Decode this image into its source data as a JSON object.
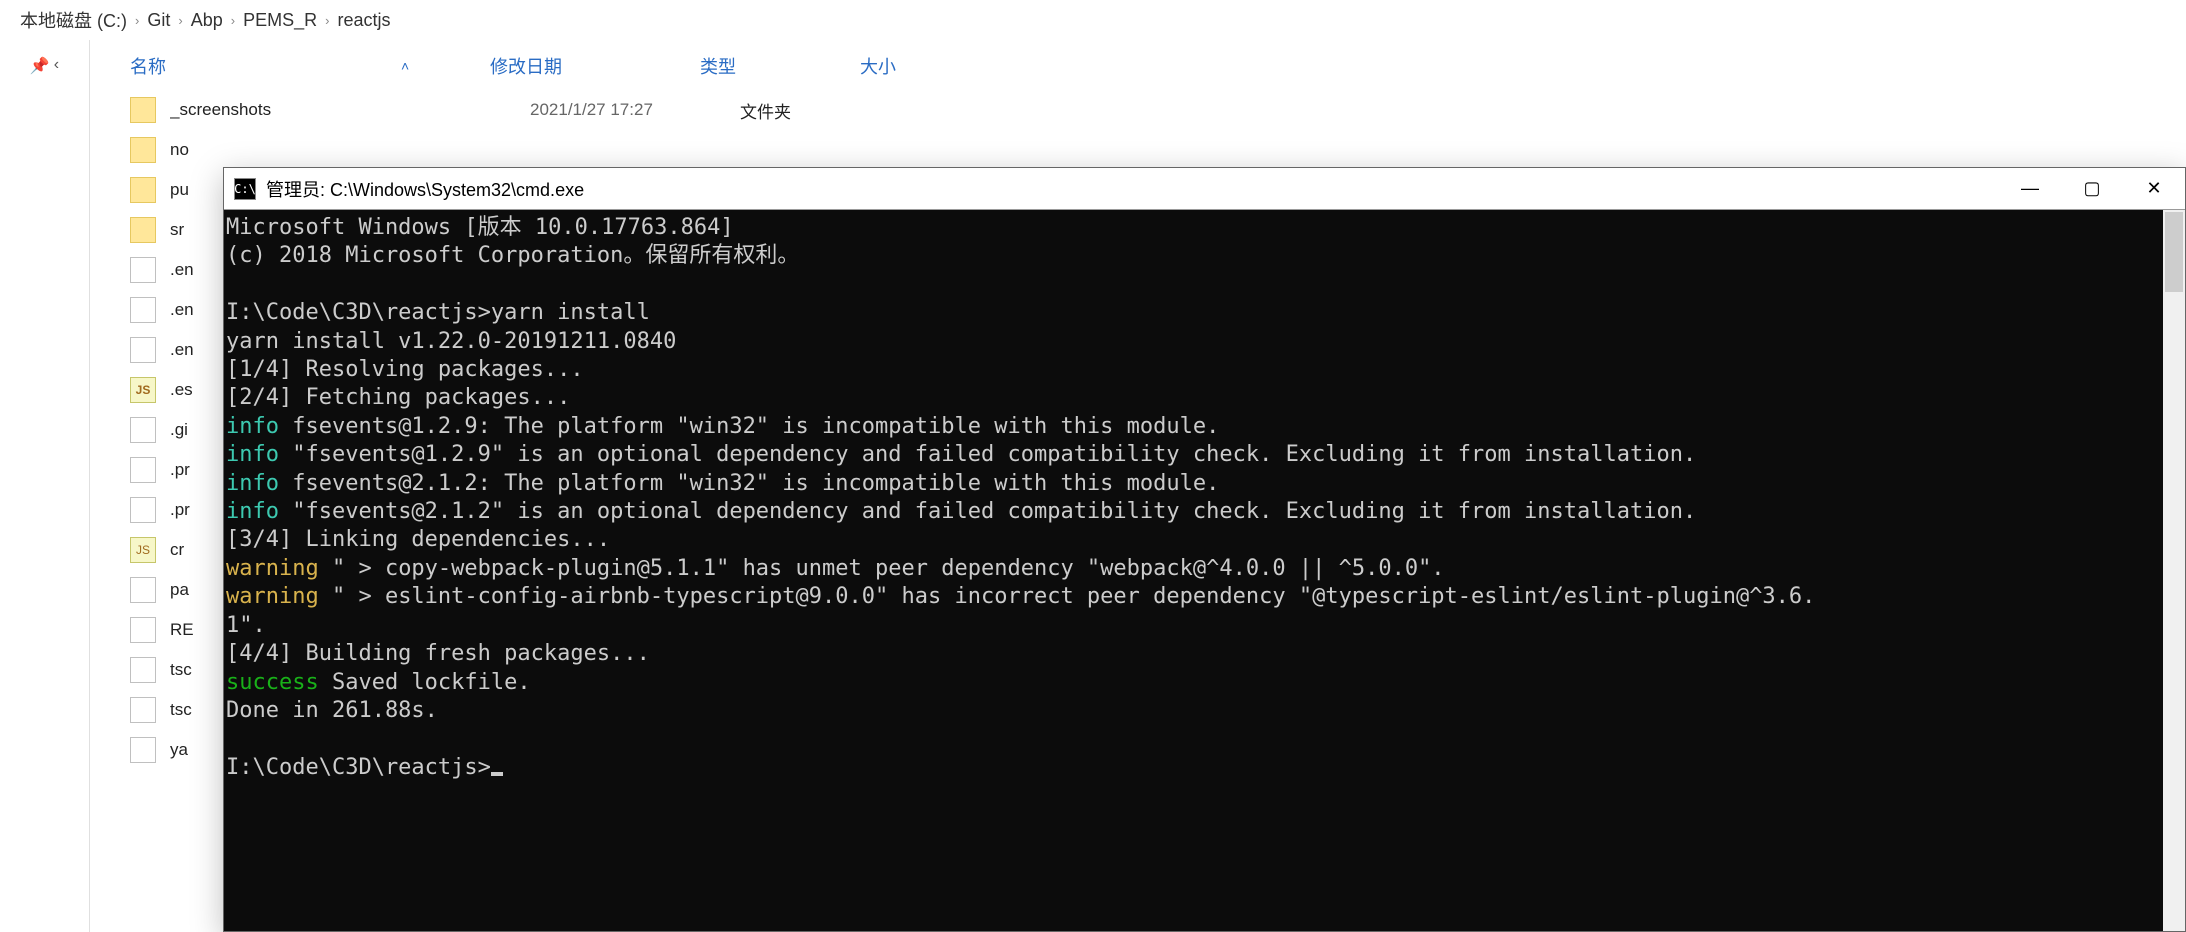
{
  "breadcrumb": [
    "本地磁盘 (C:)",
    "Git",
    "Abp",
    "PEMS_R",
    "reactjs"
  ],
  "columns": {
    "name": "名称",
    "modified": "修改日期",
    "type": "类型",
    "size": "大小"
  },
  "files": [
    {
      "icon": "folder",
      "name": "_screenshots",
      "date": "2021/1/27 17:27",
      "type": "文件夹",
      "size": ""
    },
    {
      "icon": "folder",
      "name": "no",
      "date": "",
      "type": "",
      "size": ""
    },
    {
      "icon": "folder",
      "name": "pu",
      "date": "",
      "type": "",
      "size": ""
    },
    {
      "icon": "folder",
      "name": "sr",
      "date": "",
      "type": "",
      "size": ""
    },
    {
      "icon": "doc",
      "name": ".en",
      "date": "",
      "type": "",
      "size": ""
    },
    {
      "icon": "doc",
      "name": ".en",
      "date": "",
      "type": "",
      "size": ""
    },
    {
      "icon": "doc",
      "name": ".en",
      "date": "",
      "type": "",
      "size": ""
    },
    {
      "icon": "eslint",
      "name": ".es",
      "date": "",
      "type": "",
      "size": ""
    },
    {
      "icon": "doc",
      "name": ".gi",
      "date": "",
      "type": "",
      "size": ""
    },
    {
      "icon": "doc",
      "name": ".pr",
      "date": "",
      "type": "",
      "size": ""
    },
    {
      "icon": "doc",
      "name": ".pr",
      "date": "",
      "type": "",
      "size": ""
    },
    {
      "icon": "craco",
      "name": "cr",
      "date": "",
      "type": "",
      "size": ""
    },
    {
      "icon": "doc",
      "name": "pa",
      "date": "",
      "type": "",
      "size": ""
    },
    {
      "icon": "doc",
      "name": "RE",
      "date": "",
      "type": "",
      "size": ""
    },
    {
      "icon": "doc",
      "name": "tsc",
      "date": "",
      "type": "",
      "size": ""
    },
    {
      "icon": "doc",
      "name": "tsc",
      "date": "",
      "type": "",
      "size": ""
    },
    {
      "icon": "doc",
      "name": "ya",
      "date": "",
      "type": "",
      "size": ""
    }
  ],
  "cmd": {
    "title": "管理员: C:\\Windows\\System32\\cmd.exe",
    "lines": [
      {
        "plain": "Microsoft Windows [版本 10.0.17763.864]"
      },
      {
        "plain": "(c) 2018 Microsoft Corporation。保留所有权利。"
      },
      {
        "plain": ""
      },
      {
        "plain": "I:\\Code\\C3D\\reactjs>yarn install"
      },
      {
        "plain": "yarn install v1.22.0-20191211.0840"
      },
      {
        "plain": "[1/4] Resolving packages..."
      },
      {
        "plain": "[2/4] Fetching packages..."
      },
      {
        "prefix": "info",
        "prefixClass": "t-info",
        "rest": " fsevents@1.2.9: The platform \"win32\" is incompatible with this module."
      },
      {
        "prefix": "info",
        "prefixClass": "t-info",
        "rest": " \"fsevents@1.2.9\" is an optional dependency and failed compatibility check. Excluding it from installation."
      },
      {
        "prefix": "info",
        "prefixClass": "t-info",
        "rest": " fsevents@2.1.2: The platform \"win32\" is incompatible with this module."
      },
      {
        "prefix": "info",
        "prefixClass": "t-info",
        "rest": " \"fsevents@2.1.2\" is an optional dependency and failed compatibility check. Excluding it from installation."
      },
      {
        "plain": "[3/4] Linking dependencies..."
      },
      {
        "prefix": "warning",
        "prefixClass": "t-warning",
        "rest": " \" > copy-webpack-plugin@5.1.1\" has unmet peer dependency \"webpack@^4.0.0 || ^5.0.0\"."
      },
      {
        "prefix": "warning",
        "prefixClass": "t-warning",
        "rest": " \" > eslint-config-airbnb-typescript@9.0.0\" has incorrect peer dependency \"@typescript-eslint/eslint-plugin@^3.6."
      },
      {
        "plain": "1\"."
      },
      {
        "plain": "[4/4] Building fresh packages..."
      },
      {
        "prefix": "success",
        "prefixClass": "t-success",
        "rest": " Saved lockfile."
      },
      {
        "plain": "Done in 261.88s."
      },
      {
        "plain": ""
      },
      {
        "prompt": "I:\\Code\\C3D\\reactjs>"
      }
    ]
  }
}
